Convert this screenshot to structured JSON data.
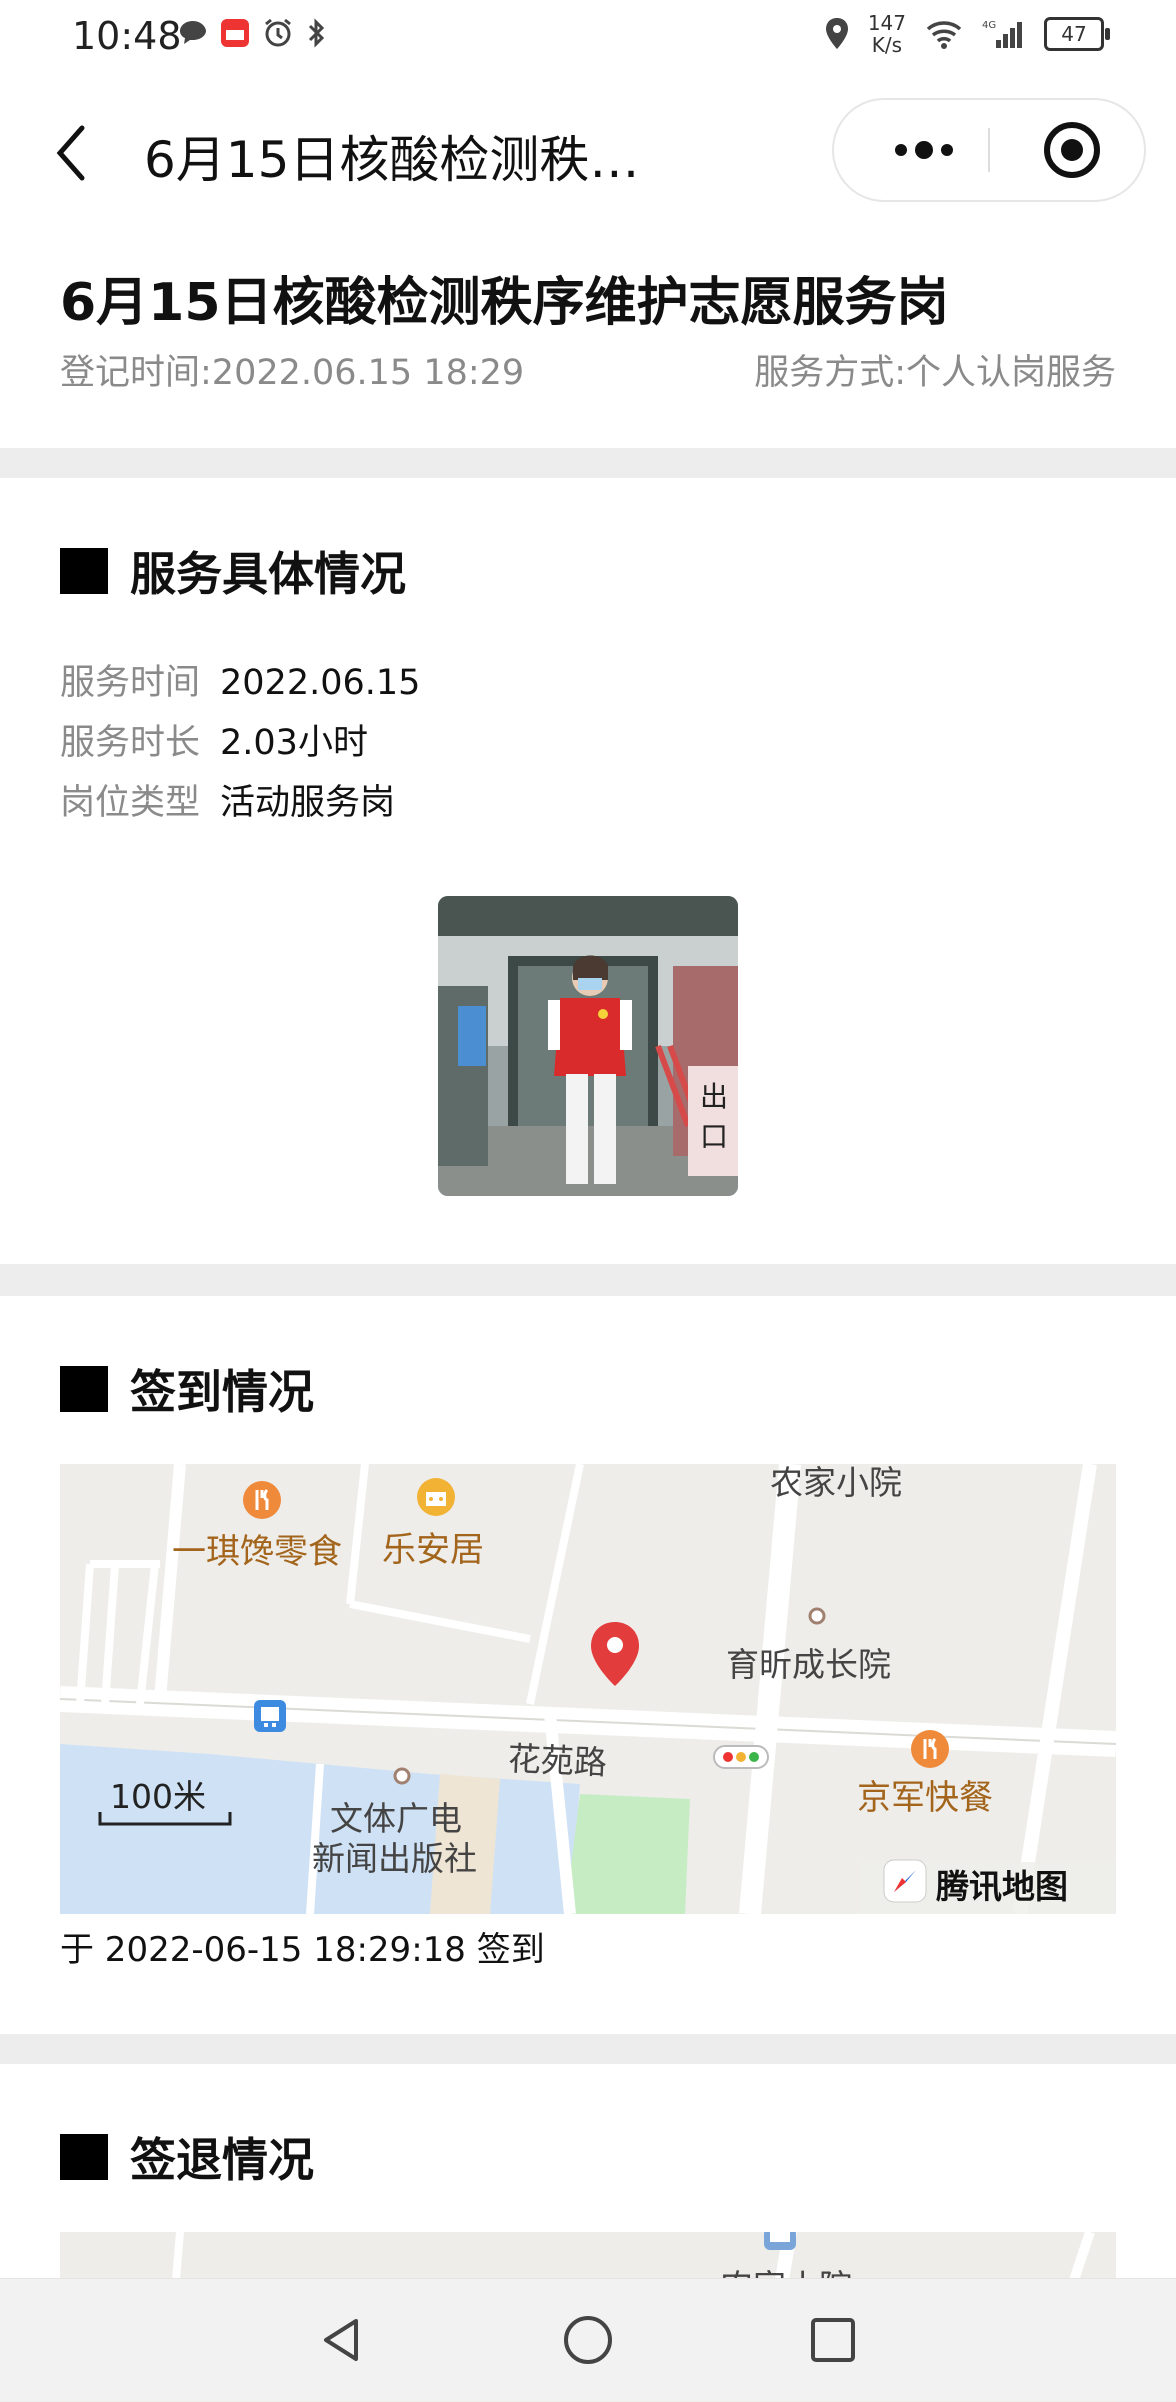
{
  "status_bar": {
    "time": "10:48",
    "net_speed_value": "147",
    "net_speed_unit": "K/s",
    "network": "4G",
    "battery": "47"
  },
  "nav": {
    "title": "6月15日核酸检测秩…",
    "more_icon": "more-dots-icon",
    "close_icon": "target-close-icon",
    "back_icon": "back-chevron-icon"
  },
  "header": {
    "title": "6月15日核酸检测秩序维护志愿服务岗",
    "register_time_label": "登记时间:",
    "register_time": "2022.06.15 18:29",
    "service_mode_label": "服务方式:",
    "service_mode": "个人认岗服务"
  },
  "service_details": {
    "section_title": "服务具体情况",
    "rows": [
      {
        "label": "服务时间",
        "value": "2022.06.15"
      },
      {
        "label": "服务时长",
        "value": "2.03小时"
      },
      {
        "label": "岗位类型",
        "value": "活动服务岗"
      }
    ],
    "photo_sign_text": "出口"
  },
  "checkin": {
    "section_title": "签到情况",
    "map": {
      "pois": [
        "一琪馋零食",
        "乐安居",
        "农家小院",
        "育昕成长院",
        "京军快餐",
        "文体广电",
        "新闻出版社"
      ],
      "road": "花苑路",
      "scale": "100米",
      "provider": "腾讯地图"
    },
    "text": "于 2022-06-15 18:29:18 签到"
  },
  "checkout": {
    "section_title": "签退情况",
    "map_label": "农家小院"
  },
  "colors": {
    "accent_red": "#e23c3c",
    "poi_orange": "#f08a3b",
    "poi_text": "#a3651c",
    "water": "#cfe2f5",
    "park": "#c6ecc4",
    "vest_red": "#d92b2b"
  }
}
